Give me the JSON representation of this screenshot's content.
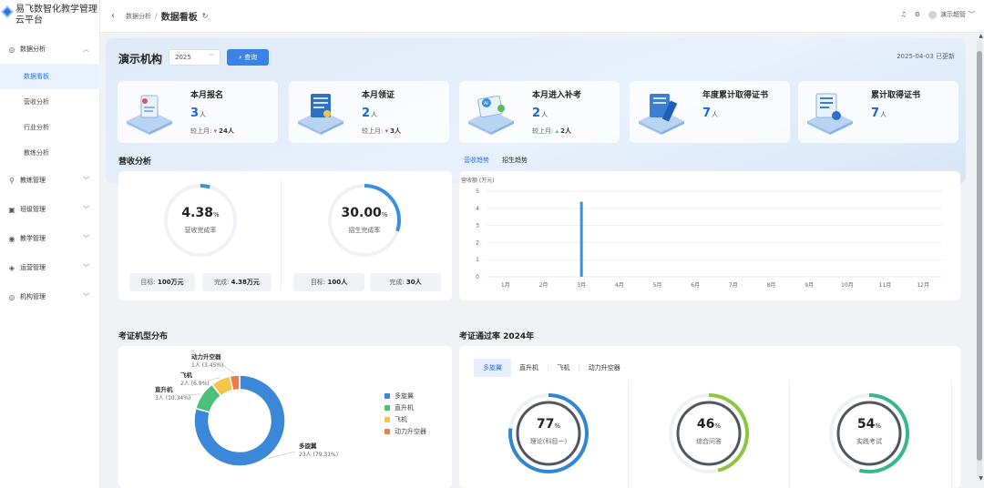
{
  "app": {
    "title": "易飞数智化教学管理云平台"
  },
  "sidebar": {
    "groups": [
      {
        "label": "数据分析",
        "icon": "chart-icon",
        "expanded": true,
        "children": [
          {
            "label": "数据看板",
            "active": true
          },
          {
            "label": "营收分析"
          },
          {
            "label": "行业分析"
          },
          {
            "label": "教练分析"
          }
        ]
      },
      {
        "label": "教练管理",
        "icon": "coach-icon"
      },
      {
        "label": "班级管理",
        "icon": "class-icon"
      },
      {
        "label": "教学管理",
        "icon": "teach-icon"
      },
      {
        "label": "运营管理",
        "icon": "ops-icon"
      },
      {
        "label": "机构管理",
        "icon": "org-icon"
      }
    ]
  },
  "topbar": {
    "breadcrumb_parent": "数据分析",
    "breadcrumb_sep": "/",
    "breadcrumb_current": "数据看板",
    "user": "演示超管"
  },
  "header": {
    "org_name": "演示机构",
    "year": "2025",
    "query_label": "查询",
    "updated": "2025-04-03 已更新"
  },
  "stats": [
    {
      "title": "本月报名",
      "value": "3",
      "unit": "人",
      "compare_label": "较上月:",
      "trend": "down",
      "compare_value": "24人"
    },
    {
      "title": "本月领证",
      "value": "2",
      "unit": "人",
      "compare_label": "较上月:",
      "trend": "down",
      "compare_value": "3人"
    },
    {
      "title": "本月进入补考",
      "value": "2",
      "unit": "人",
      "compare_label": "较上月:",
      "trend": "up",
      "compare_value": "2人"
    },
    {
      "title": "年度累计取得证书",
      "value": "7",
      "unit": "人"
    },
    {
      "title": "累计取得证书",
      "value": "7",
      "unit": "人"
    }
  ],
  "revenue": {
    "title": "营收分析",
    "rings": [
      {
        "value": "4.38",
        "unit": "%",
        "label": "营收完成率",
        "target_label": "目标:",
        "target": "100万元",
        "done_label": "完成:",
        "done": "4.38万元",
        "pct": 4.38
      },
      {
        "value": "30.00",
        "unit": "%",
        "label": "招生完成率",
        "target_label": "目标:",
        "target": "100人",
        "done_label": "完成:",
        "done": "30人",
        "pct": 30
      }
    ]
  },
  "trend": {
    "tabs": [
      "营收趋势",
      "招生趋势"
    ],
    "active_tab": 0,
    "chart_data": {
      "type": "bar",
      "ylabel": "营收额 (万元)",
      "categories": [
        "1月",
        "2月",
        "3月",
        "4月",
        "5月",
        "6月",
        "7月",
        "8月",
        "9月",
        "10月",
        "11月",
        "12月"
      ],
      "values": [
        0,
        0,
        4.38,
        0,
        0,
        0,
        0,
        0,
        0,
        0,
        0,
        0
      ],
      "yticks": [
        "0",
        "1",
        "2",
        "3",
        "4",
        "5"
      ],
      "ylim": [
        0,
        5
      ],
      "color": "#3b8fe0"
    }
  },
  "dist": {
    "title": "考证机型分布",
    "chart_data": {
      "type": "pie",
      "slices": [
        {
          "name": "多旋翼",
          "label": "23人 (79.31%)",
          "value": 23,
          "color": "#3b87d8"
        },
        {
          "name": "直升机",
          "label": "3人 (10.34%)",
          "value": 3,
          "color": "#4cbf7a"
        },
        {
          "name": "飞机",
          "label": "2人 (6.9%)",
          "value": 2,
          "color": "#f3c64a"
        },
        {
          "name": "动力升空器",
          "label": "1人 (3.45%)",
          "value": 1,
          "color": "#ee7a4e"
        }
      ]
    }
  },
  "pass": {
    "title": "考证通过率 2024年",
    "tabs": [
      "多旋翼",
      "直升机",
      "飞机",
      "动力升空器"
    ],
    "active_tab": 0,
    "rings": [
      {
        "value": "77",
        "unit": "%",
        "label": "理论(科目一)",
        "pct": 77,
        "color": "#2f86d3"
      },
      {
        "value": "46",
        "unit": "%",
        "label": "综合问答",
        "pct": 46,
        "color": "#8cc63f"
      },
      {
        "value": "54",
        "unit": "%",
        "label": "实践考试",
        "pct": 54,
        "color": "#36b88c"
      }
    ]
  }
}
